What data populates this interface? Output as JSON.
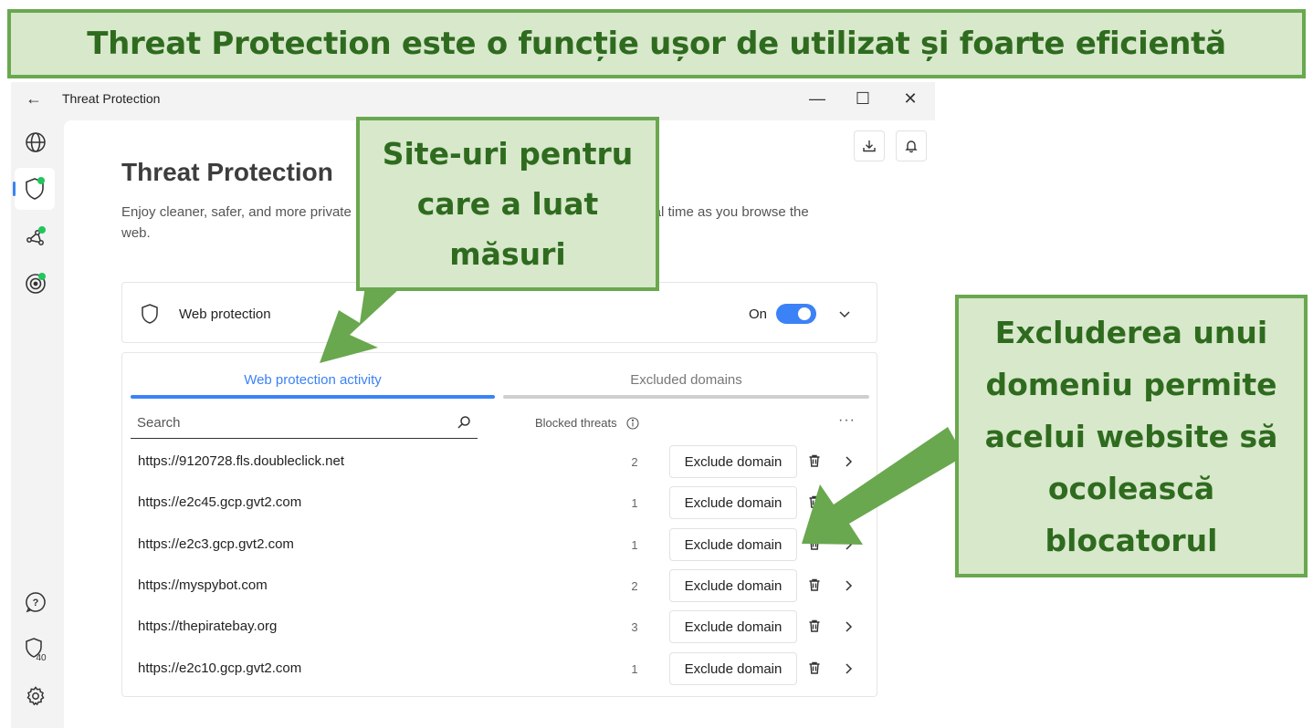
{
  "banner": {
    "text": "Threat Protection este o funcție ușor de utilizat și foarte eficientă"
  },
  "titlebar": {
    "title": "Threat Protection",
    "back": "←",
    "minimize": "—",
    "maximize": "☐",
    "close": "✕"
  },
  "sidebar": {
    "items": [
      {
        "icon": "globe-icon"
      },
      {
        "icon": "shield-icon",
        "active": true
      },
      {
        "icon": "network-icon"
      },
      {
        "icon": "target-icon"
      }
    ],
    "bottom": [
      {
        "icon": "help-icon"
      },
      {
        "icon": "shield-badge-icon",
        "badge": "40"
      },
      {
        "icon": "gear-icon"
      }
    ]
  },
  "page": {
    "title": "Threat Protection",
    "description_left": "Enjoy cleaner, safer, and more private",
    "description_right": "s in real time as you browse the",
    "description_wrap": "web."
  },
  "web_protection": {
    "label": "Web protection",
    "state": "On"
  },
  "tabs": [
    {
      "label": "Web protection activity",
      "active": true
    },
    {
      "label": "Excluded domains",
      "active": false
    }
  ],
  "search": {
    "placeholder": "Search"
  },
  "table": {
    "header": "Blocked threats",
    "more": "···",
    "action_label": "Exclude domain",
    "rows": [
      {
        "url": "https://9120728.fls.doubleclick.net",
        "count": "2"
      },
      {
        "url": "https://e2c45.gcp.gvt2.com",
        "count": "1"
      },
      {
        "url": "https://e2c3.gcp.gvt2.com",
        "count": "1"
      },
      {
        "url": "https://myspybot.com",
        "count": "2"
      },
      {
        "url": "https://thepiratebay.org",
        "count": "3"
      },
      {
        "url": "https://e2c10.gcp.gvt2.com",
        "count": "1"
      }
    ]
  },
  "callouts": {
    "sites": [
      "Site-uri pentru",
      "care a luat",
      "măsuri"
    ],
    "exclude": [
      "Excluderea unui",
      "domeniu permite",
      "acelui website să",
      "ocolească",
      "blocatorul"
    ]
  },
  "colors": {
    "accent": "#3b82f6",
    "callout_bg": "#d7e8cb",
    "callout_border": "#69a84f",
    "callout_text": "#2f6b1f",
    "status_dot": "#22c55e"
  }
}
